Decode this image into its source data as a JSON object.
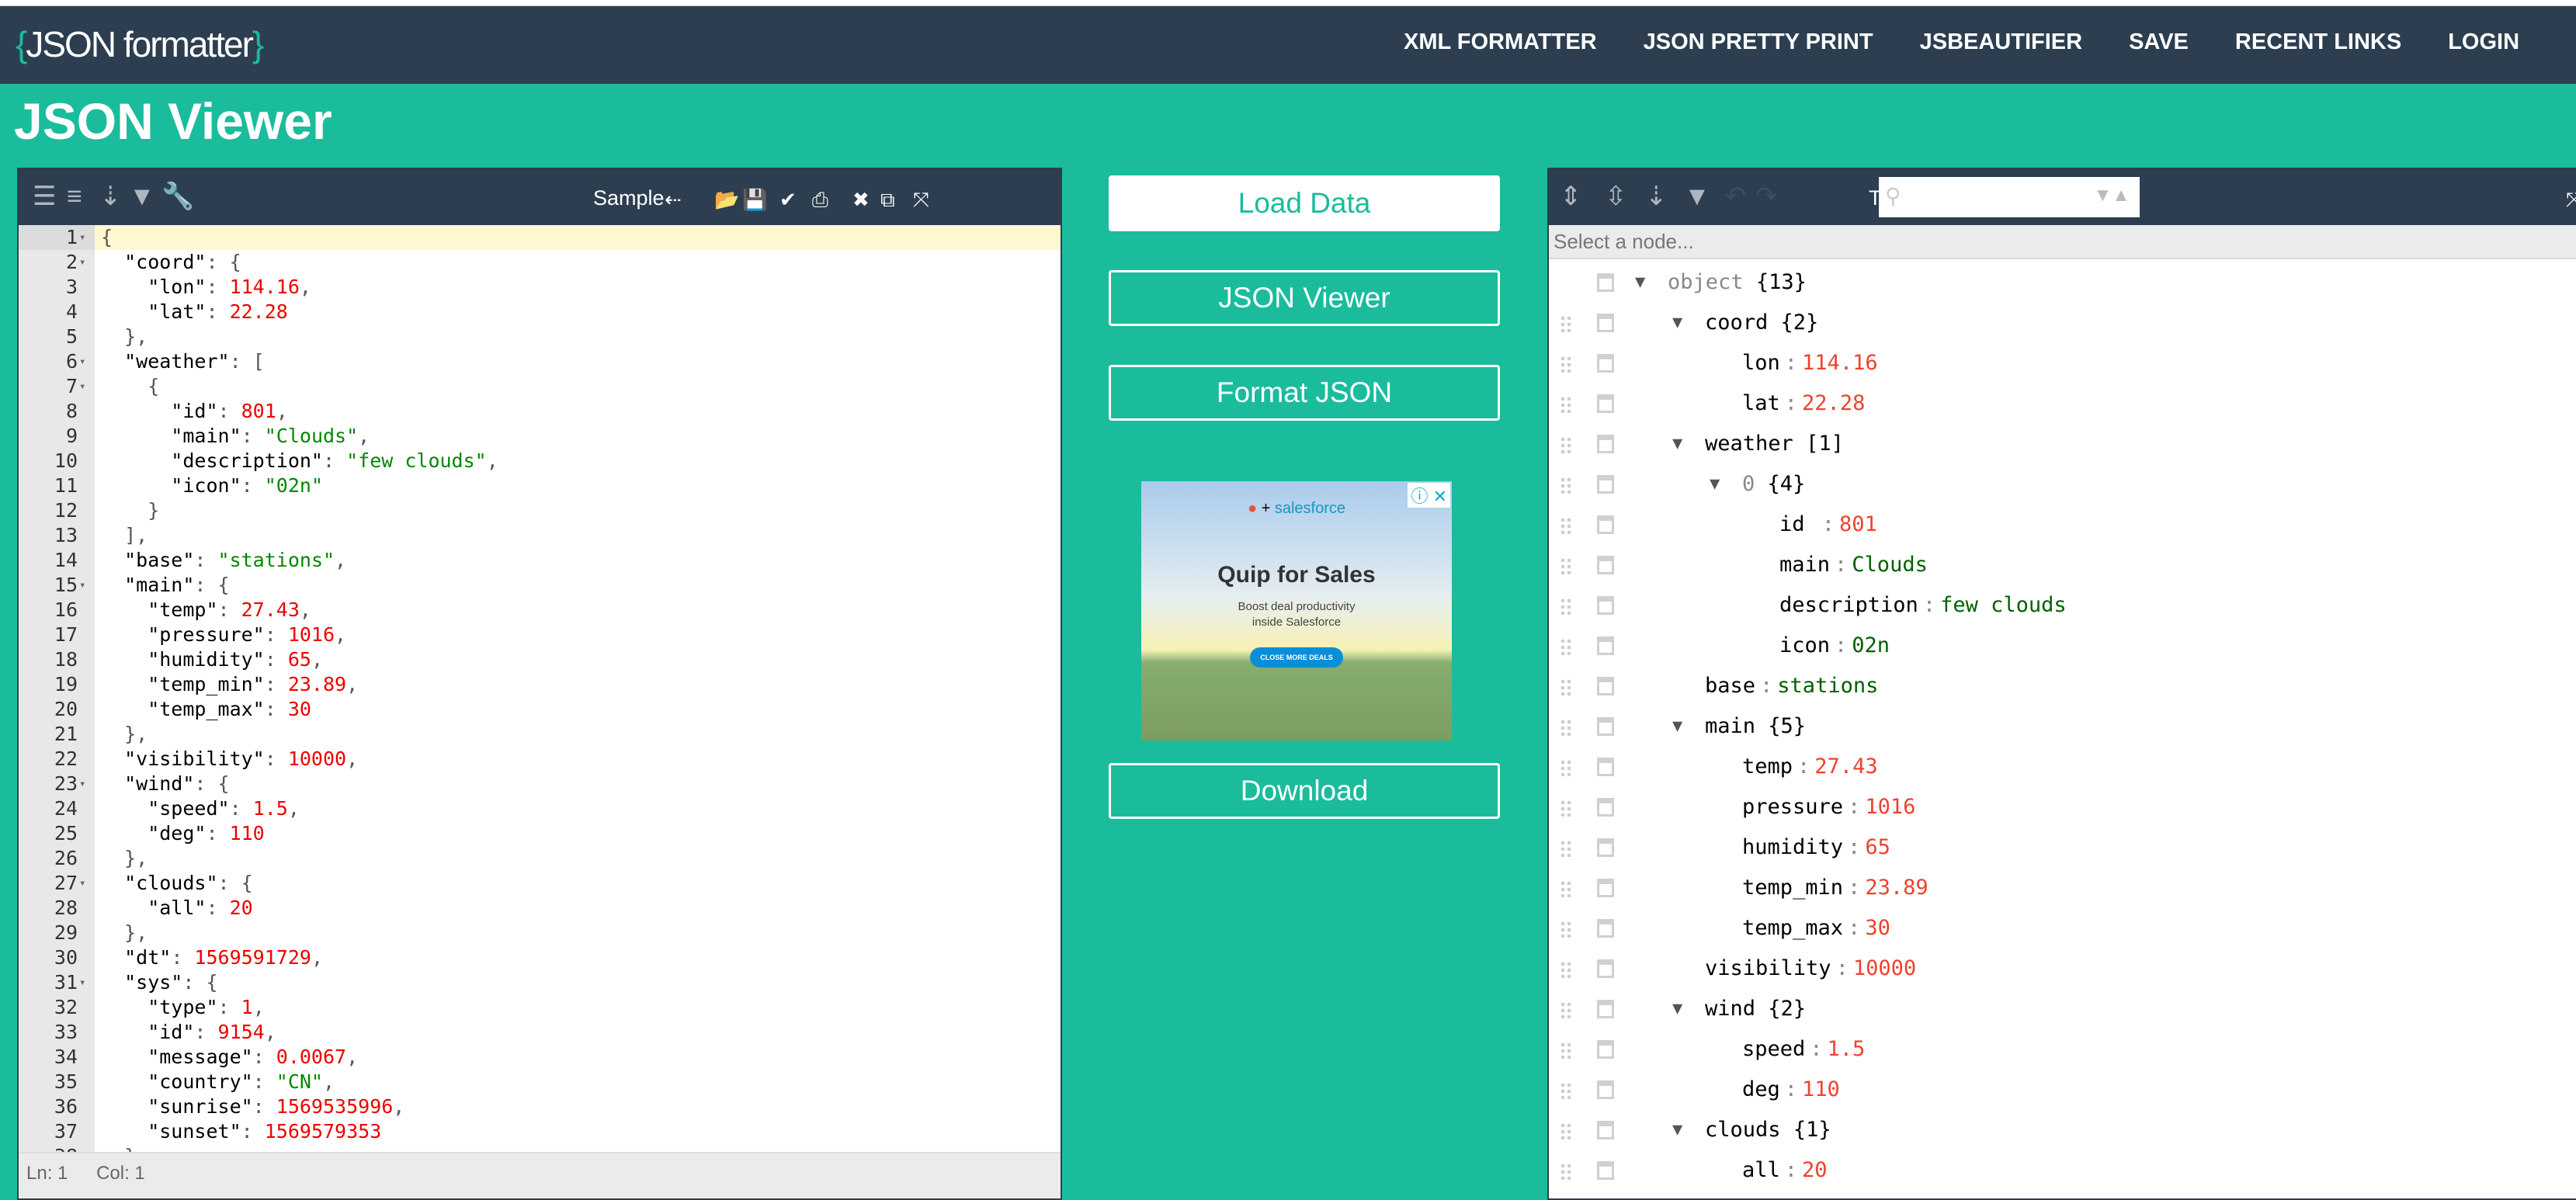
{
  "nav": {
    "logo": "JSON formatter",
    "links": [
      "XML FORMATTER",
      "JSON PRETTY PRINT",
      "JSBEAUTIFIER",
      "SAVE",
      "RECENT LINKS",
      "LOGIN"
    ]
  },
  "page_title": "JSON Viewer",
  "editor": {
    "toolbar": {
      "sample_label": "Sample"
    },
    "status": {
      "ln": "Ln: 1",
      "col": "Col: 1"
    },
    "lines": [
      [
        [
          "p",
          "{"
        ]
      ],
      [
        [
          "k",
          "  \"coord\""
        ],
        [
          "p",
          ": {"
        ]
      ],
      [
        [
          "k",
          "    \"lon\""
        ],
        [
          "p",
          ": "
        ],
        [
          "n",
          "114.16"
        ],
        [
          "p",
          ","
        ]
      ],
      [
        [
          "k",
          "    \"lat\""
        ],
        [
          "p",
          ": "
        ],
        [
          "n",
          "22.28"
        ]
      ],
      [
        [
          "p",
          "  },"
        ]
      ],
      [
        [
          "k",
          "  \"weather\""
        ],
        [
          "p",
          ": ["
        ]
      ],
      [
        [
          "p",
          "    {"
        ]
      ],
      [
        [
          "k",
          "      \"id\""
        ],
        [
          "p",
          ": "
        ],
        [
          "n",
          "801"
        ],
        [
          "p",
          ","
        ]
      ],
      [
        [
          "k",
          "      \"main\""
        ],
        [
          "p",
          ": "
        ],
        [
          "s",
          "\"Clouds\""
        ],
        [
          "p",
          ","
        ]
      ],
      [
        [
          "k",
          "      \"description\""
        ],
        [
          "p",
          ": "
        ],
        [
          "s",
          "\"few clouds\""
        ],
        [
          "p",
          ","
        ]
      ],
      [
        [
          "k",
          "      \"icon\""
        ],
        [
          "p",
          ": "
        ],
        [
          "s",
          "\"02n\""
        ]
      ],
      [
        [
          "p",
          "    }"
        ]
      ],
      [
        [
          "p",
          "  ],"
        ]
      ],
      [
        [
          "k",
          "  \"base\""
        ],
        [
          "p",
          ": "
        ],
        [
          "s",
          "\"stations\""
        ],
        [
          "p",
          ","
        ]
      ],
      [
        [
          "k",
          "  \"main\""
        ],
        [
          "p",
          ": {"
        ]
      ],
      [
        [
          "k",
          "    \"temp\""
        ],
        [
          "p",
          ": "
        ],
        [
          "n",
          "27.43"
        ],
        [
          "p",
          ","
        ]
      ],
      [
        [
          "k",
          "    \"pressure\""
        ],
        [
          "p",
          ": "
        ],
        [
          "n",
          "1016"
        ],
        [
          "p",
          ","
        ]
      ],
      [
        [
          "k",
          "    \"humidity\""
        ],
        [
          "p",
          ": "
        ],
        [
          "n",
          "65"
        ],
        [
          "p",
          ","
        ]
      ],
      [
        [
          "k",
          "    \"temp_min\""
        ],
        [
          "p",
          ": "
        ],
        [
          "n",
          "23.89"
        ],
        [
          "p",
          ","
        ]
      ],
      [
        [
          "k",
          "    \"temp_max\""
        ],
        [
          "p",
          ": "
        ],
        [
          "n",
          "30"
        ]
      ],
      [
        [
          "p",
          "  },"
        ]
      ],
      [
        [
          "k",
          "  \"visibility\""
        ],
        [
          "p",
          ": "
        ],
        [
          "n",
          "10000"
        ],
        [
          "p",
          ","
        ]
      ],
      [
        [
          "k",
          "  \"wind\""
        ],
        [
          "p",
          ": {"
        ]
      ],
      [
        [
          "k",
          "    \"speed\""
        ],
        [
          "p",
          ": "
        ],
        [
          "n",
          "1.5"
        ],
        [
          "p",
          ","
        ]
      ],
      [
        [
          "k",
          "    \"deg\""
        ],
        [
          "p",
          ": "
        ],
        [
          "n",
          "110"
        ]
      ],
      [
        [
          "p",
          "  },"
        ]
      ],
      [
        [
          "k",
          "  \"clouds\""
        ],
        [
          "p",
          ": {"
        ]
      ],
      [
        [
          "k",
          "    \"all\""
        ],
        [
          "p",
          ": "
        ],
        [
          "n",
          "20"
        ]
      ],
      [
        [
          "p",
          "  },"
        ]
      ],
      [
        [
          "k",
          "  \"dt\""
        ],
        [
          "p",
          ": "
        ],
        [
          "n",
          "1569591729"
        ],
        [
          "p",
          ","
        ]
      ],
      [
        [
          "k",
          "  \"sys\""
        ],
        [
          "p",
          ": {"
        ]
      ],
      [
        [
          "k",
          "    \"type\""
        ],
        [
          "p",
          ": "
        ],
        [
          "n",
          "1"
        ],
        [
          "p",
          ","
        ]
      ],
      [
        [
          "k",
          "    \"id\""
        ],
        [
          "p",
          ": "
        ],
        [
          "n",
          "9154"
        ],
        [
          "p",
          ","
        ]
      ],
      [
        [
          "k",
          "    \"message\""
        ],
        [
          "p",
          ": "
        ],
        [
          "n",
          "0.0067"
        ],
        [
          "p",
          ","
        ]
      ],
      [
        [
          "k",
          "    \"country\""
        ],
        [
          "p",
          ": "
        ],
        [
          "s",
          "\"CN\""
        ],
        [
          "p",
          ","
        ]
      ],
      [
        [
          "k",
          "    \"sunrise\""
        ],
        [
          "p",
          ": "
        ],
        [
          "n",
          "1569535996"
        ],
        [
          "p",
          ","
        ]
      ],
      [
        [
          "k",
          "    \"sunset\""
        ],
        [
          "p",
          ": "
        ],
        [
          "n",
          "1569579353"
        ]
      ],
      [
        [
          "p",
          "  },"
        ]
      ]
    ],
    "folds": [
      1,
      2,
      6,
      7,
      15,
      23,
      27,
      31
    ]
  },
  "actions": {
    "load": "Load Data",
    "viewer": "JSON Viewer",
    "format": "Format JSON",
    "download": "Download"
  },
  "ad": {
    "headline": "Quip for Sales",
    "sub1": "Boost deal productivity",
    "sub2": "inside Salesforce",
    "cta": "CLOSE MORE DEALS",
    "logo_text": "salesforce"
  },
  "viewer": {
    "mode": "Tree ▾",
    "select_placeholder": "Select a node...",
    "colors": {
      "number": "#ee422e",
      "string": "#006000"
    },
    "rows": [
      {
        "l": 0,
        "key": "object",
        "meta": "{13}",
        "open": true,
        "root": true
      },
      {
        "l": 1,
        "key": "coord",
        "meta": "{2}",
        "open": true
      },
      {
        "l": 2,
        "key": "lon",
        "val": "114.16",
        "t": "n"
      },
      {
        "l": 2,
        "key": "lat",
        "val": "22.28",
        "t": "n"
      },
      {
        "l": 1,
        "key": "weather",
        "meta": "[1]",
        "open": true
      },
      {
        "l": 2,
        "key": "0",
        "meta": "{4}",
        "open": true,
        "idx": true
      },
      {
        "l": 3,
        "key": "id  ",
        "val": "801",
        "t": "n"
      },
      {
        "l": 3,
        "key": "main",
        "val": "Clouds",
        "t": "s"
      },
      {
        "l": 3,
        "key": "description",
        "val": "few clouds",
        "t": "s"
      },
      {
        "l": 3,
        "key": "icon",
        "val": "02n",
        "t": "s"
      },
      {
        "l": 1,
        "key": "base",
        "val": "stations",
        "t": "s"
      },
      {
        "l": 1,
        "key": "main",
        "meta": "{5}",
        "open": true
      },
      {
        "l": 2,
        "key": "temp",
        "val": "27.43",
        "t": "n"
      },
      {
        "l": 2,
        "key": "pressure",
        "val": "1016",
        "t": "n"
      },
      {
        "l": 2,
        "key": "humidity",
        "val": "65",
        "t": "n"
      },
      {
        "l": 2,
        "key": "temp_min",
        "val": "23.89",
        "t": "n"
      },
      {
        "l": 2,
        "key": "temp_max",
        "val": "30",
        "t": "n"
      },
      {
        "l": 1,
        "key": "visibility",
        "val": "10000",
        "t": "n"
      },
      {
        "l": 1,
        "key": "wind",
        "meta": "{2}",
        "open": true
      },
      {
        "l": 2,
        "key": "speed",
        "val": "1.5",
        "t": "n"
      },
      {
        "l": 2,
        "key": "deg",
        "val": "110",
        "t": "n"
      },
      {
        "l": 1,
        "key": "clouds",
        "meta": "{1}",
        "open": true
      },
      {
        "l": 2,
        "key": "all",
        "val": "20",
        "t": "n"
      }
    ]
  }
}
